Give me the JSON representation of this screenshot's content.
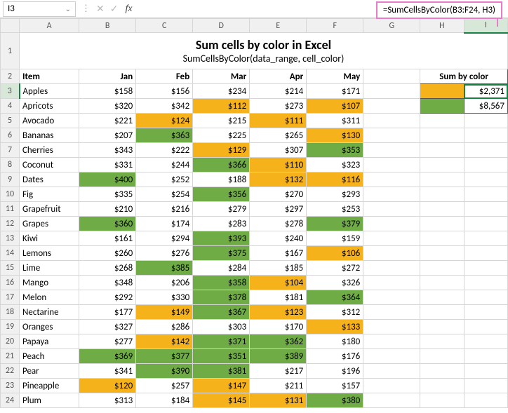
{
  "namebox": {
    "value": "I3",
    "chevron": "⌄"
  },
  "formula_bar": {
    "cancel": "✕",
    "confirm": "✓",
    "fx": "fx",
    "value": ""
  },
  "callout": "=SumCellsByColor(B3:F24, H3)",
  "columns": [
    "A",
    "B",
    "C",
    "D",
    "E",
    "F",
    "G",
    "H",
    "I"
  ],
  "row_numbers": [
    1,
    2,
    3,
    4,
    5,
    6,
    7,
    8,
    9,
    10,
    11,
    12,
    13,
    14,
    15,
    16,
    17,
    18,
    19,
    20,
    21,
    22,
    23,
    24
  ],
  "title": "Sum cells by color in Excel",
  "subtitle": "SumCellsByColor(data_range, cell_color)",
  "headers": {
    "item": "Item",
    "jan": "Jan",
    "feb": "Feb",
    "mar": "Mar",
    "apr": "Apr",
    "may": "May"
  },
  "sum_header": "Sum by color",
  "sums": {
    "orange": "$2,371",
    "green": "$8,567"
  },
  "rows": [
    {
      "item": "Apples",
      "jan": {
        "v": "$158"
      },
      "feb": {
        "v": "$156"
      },
      "mar": {
        "v": "$234"
      },
      "apr": {
        "v": "$214"
      },
      "may": {
        "v": "$171"
      }
    },
    {
      "item": "Apricots",
      "jan": {
        "v": "$320"
      },
      "feb": {
        "v": "$342"
      },
      "mar": {
        "v": "$112",
        "c": "f-orange"
      },
      "apr": {
        "v": "$273"
      },
      "may": {
        "v": "$107",
        "c": "f-orange"
      }
    },
    {
      "item": "Avocado",
      "jan": {
        "v": "$221"
      },
      "feb": {
        "v": "$124",
        "c": "f-orange"
      },
      "mar": {
        "v": "$215"
      },
      "apr": {
        "v": "$111",
        "c": "f-orange"
      },
      "may": {
        "v": "$311"
      }
    },
    {
      "item": "Bananas",
      "jan": {
        "v": "$207"
      },
      "feb": {
        "v": "$363",
        "c": "f-green"
      },
      "mar": {
        "v": "$225"
      },
      "apr": {
        "v": "$265"
      },
      "may": {
        "v": "$130",
        "c": "f-orange"
      }
    },
    {
      "item": "Cherries",
      "jan": {
        "v": "$343"
      },
      "feb": {
        "v": "$222"
      },
      "mar": {
        "v": "$129",
        "c": "f-orange"
      },
      "apr": {
        "v": "$307"
      },
      "may": {
        "v": "$353",
        "c": "f-green"
      }
    },
    {
      "item": "Coconut",
      "jan": {
        "v": "$331"
      },
      "feb": {
        "v": "$244"
      },
      "mar": {
        "v": "$366",
        "c": "f-green"
      },
      "apr": {
        "v": "$110",
        "c": "f-orange"
      },
      "may": {
        "v": "$323"
      }
    },
    {
      "item": "Dates",
      "jan": {
        "v": "$400",
        "c": "f-green"
      },
      "feb": {
        "v": "$252"
      },
      "mar": {
        "v": "$188"
      },
      "apr": {
        "v": "$132",
        "c": "f-orange"
      },
      "may": {
        "v": "$116",
        "c": "f-orange"
      }
    },
    {
      "item": "Fig",
      "jan": {
        "v": "$335"
      },
      "feb": {
        "v": "$254"
      },
      "mar": {
        "v": "$356",
        "c": "f-green"
      },
      "apr": {
        "v": "$270"
      },
      "may": {
        "v": "$293"
      }
    },
    {
      "item": "Grapefruit",
      "jan": {
        "v": "$210"
      },
      "feb": {
        "v": "$216"
      },
      "mar": {
        "v": "$279"
      },
      "apr": {
        "v": "$297"
      },
      "may": {
        "v": "$253"
      }
    },
    {
      "item": "Grapes",
      "jan": {
        "v": "$360",
        "c": "f-green"
      },
      "feb": {
        "v": "$174"
      },
      "mar": {
        "v": "$283"
      },
      "apr": {
        "v": "$278"
      },
      "may": {
        "v": "$379",
        "c": "f-green"
      }
    },
    {
      "item": "Kiwi",
      "jan": {
        "v": "$161"
      },
      "feb": {
        "v": "$294"
      },
      "mar": {
        "v": "$393",
        "c": "f-green"
      },
      "apr": {
        "v": "$240"
      },
      "may": {
        "v": "$159"
      }
    },
    {
      "item": "Lemons",
      "jan": {
        "v": "$260"
      },
      "feb": {
        "v": "$276"
      },
      "mar": {
        "v": "$375",
        "c": "f-green"
      },
      "apr": {
        "v": "$167"
      },
      "may": {
        "v": "$106",
        "c": "f-orange"
      }
    },
    {
      "item": "Lime",
      "jan": {
        "v": "$268"
      },
      "feb": {
        "v": "$385",
        "c": "f-green"
      },
      "mar": {
        "v": "$284"
      },
      "apr": {
        "v": "$185"
      },
      "may": {
        "v": "$272"
      }
    },
    {
      "item": "Mango",
      "jan": {
        "v": "$348"
      },
      "feb": {
        "v": "$206"
      },
      "mar": {
        "v": "$358",
        "c": "f-green"
      },
      "apr": {
        "v": "$104",
        "c": "f-orange"
      },
      "may": {
        "v": "$326"
      }
    },
    {
      "item": "Melon",
      "jan": {
        "v": "$292"
      },
      "feb": {
        "v": "$330"
      },
      "mar": {
        "v": "$378",
        "c": "f-green"
      },
      "apr": {
        "v": "$181"
      },
      "may": {
        "v": "$364",
        "c": "f-green"
      }
    },
    {
      "item": "Nectarine",
      "jan": {
        "v": "$177"
      },
      "feb": {
        "v": "$149",
        "c": "f-orange"
      },
      "mar": {
        "v": "$367",
        "c": "f-green"
      },
      "apr": {
        "v": "$123",
        "c": "f-orange"
      },
      "may": {
        "v": "$312"
      }
    },
    {
      "item": "Oranges",
      "jan": {
        "v": "$327"
      },
      "feb": {
        "v": "$286"
      },
      "mar": {
        "v": "$303"
      },
      "apr": {
        "v": "$170"
      },
      "may": {
        "v": "$133",
        "c": "f-orange"
      }
    },
    {
      "item": "Papaya",
      "jan": {
        "v": "$277"
      },
      "feb": {
        "v": "$142",
        "c": "f-orange"
      },
      "mar": {
        "v": "$371",
        "c": "f-green"
      },
      "apr": {
        "v": "$362",
        "c": "f-green"
      },
      "may": {
        "v": "$180"
      }
    },
    {
      "item": "Peach",
      "jan": {
        "v": "$369",
        "c": "f-green"
      },
      "feb": {
        "v": "$377",
        "c": "f-green"
      },
      "mar": {
        "v": "$351",
        "c": "f-green"
      },
      "apr": {
        "v": "$389",
        "c": "f-green"
      },
      "may": {
        "v": "$176"
      }
    },
    {
      "item": "Pear",
      "jan": {
        "v": "$341"
      },
      "feb": {
        "v": "$390",
        "c": "f-green"
      },
      "mar": {
        "v": "$381",
        "c": "f-green"
      },
      "apr": {
        "v": "$217"
      },
      "may": {
        "v": "$196"
      }
    },
    {
      "item": "Pineapple",
      "jan": {
        "v": "$120",
        "c": "f-orange"
      },
      "feb": {
        "v": "$257"
      },
      "mar": {
        "v": "$147",
        "c": "f-orange"
      },
      "apr": {
        "v": "$211"
      },
      "may": {
        "v": "$157"
      }
    },
    {
      "item": "Plum",
      "jan": {
        "v": "$313"
      },
      "feb": {
        "v": "$184"
      },
      "mar": {
        "v": "$145",
        "c": "f-orange"
      },
      "apr": {
        "v": "$131",
        "c": "f-orange"
      },
      "may": {
        "v": "$380",
        "c": "f-green"
      }
    }
  ]
}
